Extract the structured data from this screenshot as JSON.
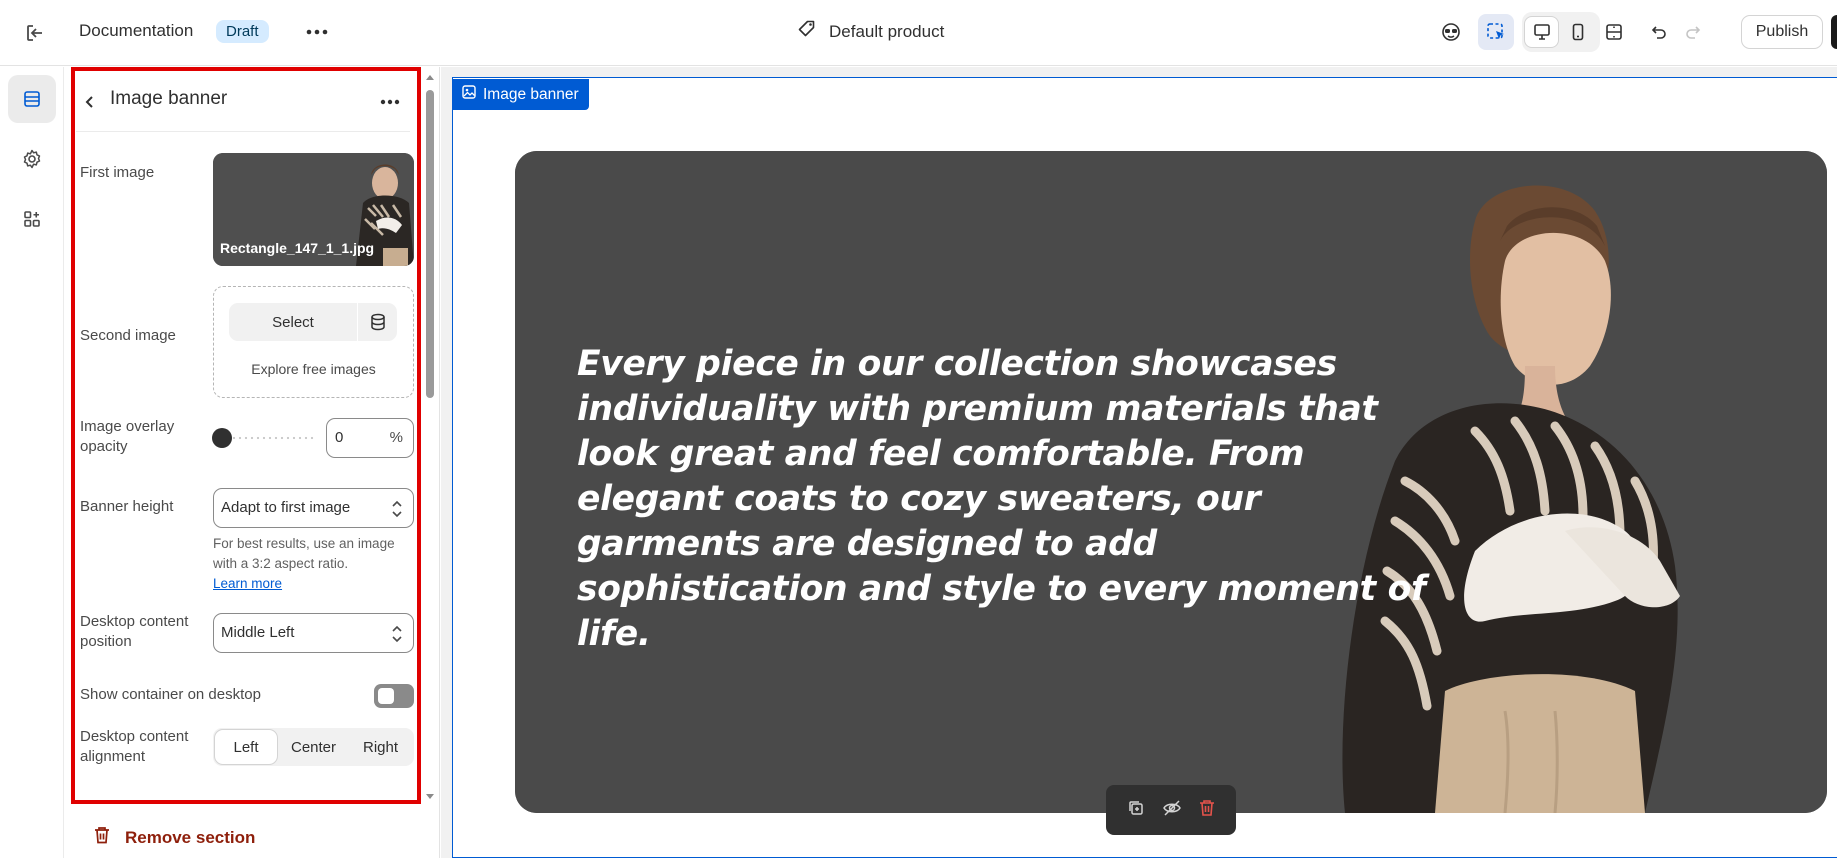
{
  "topbar": {
    "doc_title": "Documentation",
    "status_badge": "Draft",
    "product_name": "Default product",
    "publish_label": "Publish"
  },
  "panel": {
    "title": "Image banner",
    "first_image": {
      "label": "First image",
      "filename": "Rectangle_147_1_1.jpg"
    },
    "second_image": {
      "label": "Second image",
      "select_label": "Select",
      "explore_label": "Explore free images"
    },
    "overlay": {
      "label": "Image overlay opacity",
      "value": "0",
      "unit": "%",
      "level": 0
    },
    "banner_height": {
      "label": "Banner height",
      "value": "Adapt to first image",
      "help": "For best results, use an image with a 3:2 aspect ratio.",
      "learn_more": "Learn more"
    },
    "content_position": {
      "label": "Desktop content position",
      "value": "Middle Left"
    },
    "show_container": {
      "label": "Show container on desktop",
      "on": false
    },
    "alignment": {
      "label": "Desktop content alignment",
      "options": [
        "Left",
        "Center",
        "Right"
      ],
      "selected": "Left"
    },
    "remove_label": "Remove section"
  },
  "preview": {
    "section_tag": "Image banner",
    "banner_text": "Every piece in our collection showcases individuality with premium materials that look great and feel comfortable. From elegant coats to cozy sweaters, our garments are designed to add sophistication and style to every moment of life."
  },
  "colors": {
    "accent": "#005bd3",
    "highlight": "#e00000",
    "banner_bg": "#4a4a4a",
    "danger": "#8e1f0b"
  }
}
